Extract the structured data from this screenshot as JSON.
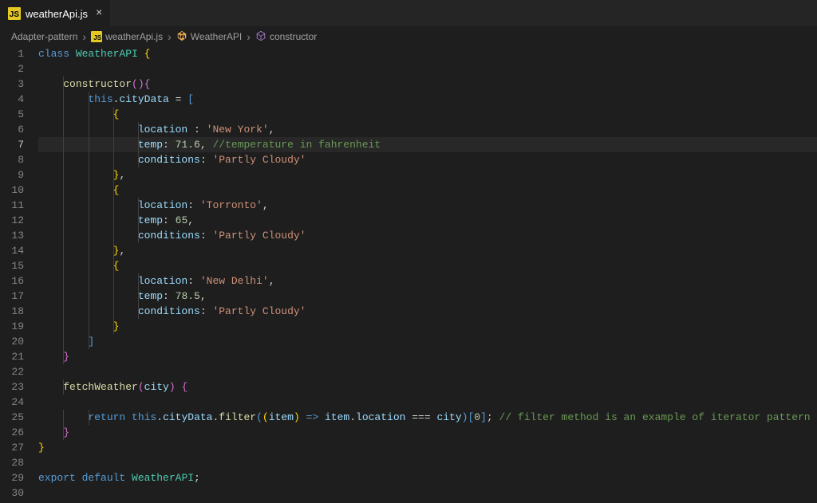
{
  "tab": {
    "icon_label": "JS",
    "filename": "weatherApi.js"
  },
  "breadcrumbs": {
    "folder": "Adapter-pattern",
    "file_icon": "JS",
    "file": "weatherApi.js",
    "class": "WeatherAPI",
    "member": "constructor"
  },
  "active_line": 7,
  "code_lines": [
    {
      "n": 1,
      "segments": [
        [
          "kw-storage",
          "class "
        ],
        [
          "kw-class",
          "WeatherAPI"
        ],
        [
          "kw-punc",
          " "
        ],
        [
          "kw-brace",
          "{"
        ]
      ]
    },
    {
      "n": 2,
      "segments": []
    },
    {
      "n": 3,
      "segments": [
        [
          "",
          "    "
        ],
        [
          "kw-fn",
          "constructor"
        ],
        [
          "kw-paren",
          "()"
        ],
        [
          "kw-brace2",
          "{"
        ]
      ]
    },
    {
      "n": 4,
      "segments": [
        [
          "",
          "        "
        ],
        [
          "kw-this",
          "this"
        ],
        [
          "kw-punc",
          "."
        ],
        [
          "kw-prop",
          "cityData"
        ],
        [
          "kw-op",
          " = "
        ],
        [
          "kw-brace3",
          "["
        ]
      ]
    },
    {
      "n": 5,
      "segments": [
        [
          "",
          "            "
        ],
        [
          "kw-brace",
          "{"
        ]
      ]
    },
    {
      "n": 6,
      "segments": [
        [
          "",
          "                "
        ],
        [
          "kw-prop",
          "location"
        ],
        [
          "kw-punc",
          " : "
        ],
        [
          "kw-str",
          "'New York'"
        ],
        [
          "kw-punc",
          ","
        ]
      ]
    },
    {
      "n": 7,
      "highlighted": true,
      "segments": [
        [
          "",
          "                "
        ],
        [
          "kw-prop",
          "temp"
        ],
        [
          "kw-punc",
          ": "
        ],
        [
          "kw-num",
          "71.6"
        ],
        [
          "kw-punc",
          ", "
        ],
        [
          "kw-comment",
          "//temperature in fahrenheit"
        ]
      ]
    },
    {
      "n": 8,
      "segments": [
        [
          "",
          "                "
        ],
        [
          "kw-prop",
          "conditions"
        ],
        [
          "kw-punc",
          ": "
        ],
        [
          "kw-str",
          "'Partly Cloudy'"
        ]
      ]
    },
    {
      "n": 9,
      "segments": [
        [
          "",
          "            "
        ],
        [
          "kw-brace",
          "}"
        ],
        [
          "kw-punc",
          ","
        ]
      ]
    },
    {
      "n": 10,
      "segments": [
        [
          "",
          "            "
        ],
        [
          "kw-brace",
          "{"
        ]
      ]
    },
    {
      "n": 11,
      "segments": [
        [
          "",
          "                "
        ],
        [
          "kw-prop",
          "location"
        ],
        [
          "kw-punc",
          ": "
        ],
        [
          "kw-str",
          "'Torronto'"
        ],
        [
          "kw-punc",
          ","
        ]
      ]
    },
    {
      "n": 12,
      "segments": [
        [
          "",
          "                "
        ],
        [
          "kw-prop",
          "temp"
        ],
        [
          "kw-punc",
          ": "
        ],
        [
          "kw-num",
          "65"
        ],
        [
          "kw-punc",
          ","
        ]
      ]
    },
    {
      "n": 13,
      "segments": [
        [
          "",
          "                "
        ],
        [
          "kw-prop",
          "conditions"
        ],
        [
          "kw-punc",
          ": "
        ],
        [
          "kw-str",
          "'Partly Cloudy'"
        ]
      ]
    },
    {
      "n": 14,
      "segments": [
        [
          "",
          "            "
        ],
        [
          "kw-brace",
          "}"
        ],
        [
          "kw-punc",
          ","
        ]
      ]
    },
    {
      "n": 15,
      "segments": [
        [
          "",
          "            "
        ],
        [
          "kw-brace",
          "{"
        ]
      ]
    },
    {
      "n": 16,
      "segments": [
        [
          "",
          "                "
        ],
        [
          "kw-prop",
          "location"
        ],
        [
          "kw-punc",
          ": "
        ],
        [
          "kw-str",
          "'New Delhi'"
        ],
        [
          "kw-punc",
          ","
        ]
      ]
    },
    {
      "n": 17,
      "segments": [
        [
          "",
          "                "
        ],
        [
          "kw-prop",
          "temp"
        ],
        [
          "kw-punc",
          ": "
        ],
        [
          "kw-num",
          "78.5"
        ],
        [
          "kw-punc",
          ","
        ]
      ]
    },
    {
      "n": 18,
      "segments": [
        [
          "",
          "                "
        ],
        [
          "kw-prop",
          "conditions"
        ],
        [
          "kw-punc",
          ": "
        ],
        [
          "kw-str",
          "'Partly Cloudy'"
        ]
      ]
    },
    {
      "n": 19,
      "segments": [
        [
          "",
          "            "
        ],
        [
          "kw-brace",
          "}"
        ]
      ]
    },
    {
      "n": 20,
      "segments": [
        [
          "",
          "        "
        ],
        [
          "kw-brace3",
          "]"
        ]
      ]
    },
    {
      "n": 21,
      "segments": [
        [
          "",
          "    "
        ],
        [
          "kw-brace2",
          "}"
        ]
      ]
    },
    {
      "n": 22,
      "segments": []
    },
    {
      "n": 23,
      "segments": [
        [
          "",
          "    "
        ],
        [
          "kw-fn",
          "fetchWeather"
        ],
        [
          "kw-paren",
          "("
        ],
        [
          "kw-param",
          "city"
        ],
        [
          "kw-paren",
          ")"
        ],
        [
          "kw-punc",
          " "
        ],
        [
          "kw-brace2",
          "{"
        ]
      ]
    },
    {
      "n": 24,
      "segments": []
    },
    {
      "n": 25,
      "segments": [
        [
          "",
          "        "
        ],
        [
          "kw-storage",
          "return "
        ],
        [
          "kw-this",
          "this"
        ],
        [
          "kw-punc",
          "."
        ],
        [
          "kw-prop",
          "cityData"
        ],
        [
          "kw-punc",
          "."
        ],
        [
          "kw-fn",
          "filter"
        ],
        [
          "kw-brace3",
          "("
        ],
        [
          "kw-brace",
          "("
        ],
        [
          "kw-param",
          "item"
        ],
        [
          "kw-brace",
          ")"
        ],
        [
          "kw-storage",
          " => "
        ],
        [
          "kw-prop",
          "item"
        ],
        [
          "kw-punc",
          "."
        ],
        [
          "kw-prop",
          "location"
        ],
        [
          "kw-op",
          " === "
        ],
        [
          "kw-prop",
          "city"
        ],
        [
          "kw-brace3",
          ")"
        ],
        [
          "kw-brace3",
          "["
        ],
        [
          "kw-num",
          "0"
        ],
        [
          "kw-brace3",
          "]"
        ],
        [
          "kw-punc",
          "; "
        ],
        [
          "kw-comment",
          "// filter method is an example of iterator pattern"
        ]
      ]
    },
    {
      "n": 26,
      "segments": [
        [
          "",
          "    "
        ],
        [
          "kw-brace2",
          "}"
        ]
      ]
    },
    {
      "n": 27,
      "segments": [
        [
          "kw-brace",
          "}"
        ]
      ]
    },
    {
      "n": 28,
      "segments": []
    },
    {
      "n": 29,
      "segments": [
        [
          "kw-storage",
          "export default "
        ],
        [
          "kw-class",
          "WeatherAPI"
        ],
        [
          "kw-punc",
          ";"
        ]
      ]
    },
    {
      "n": 30,
      "segments": []
    }
  ]
}
